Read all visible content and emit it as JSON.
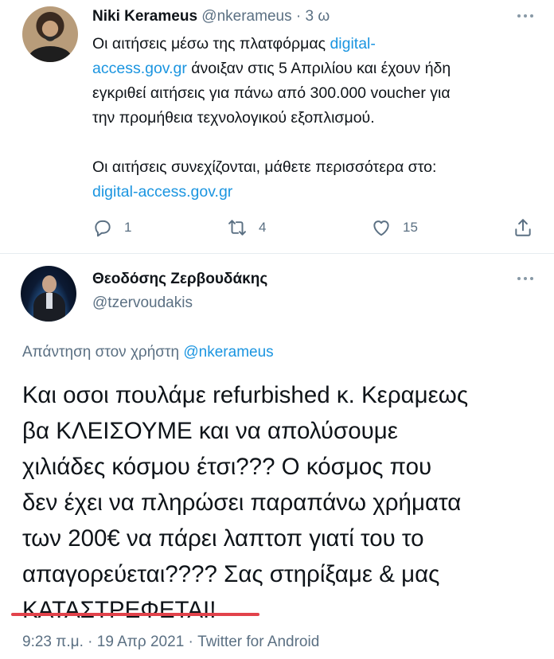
{
  "tweet1": {
    "author_name": "Niki Kerameus",
    "handle": "@nkerameus",
    "separator": "·",
    "time": "3 ω",
    "body_lines": [
      [
        {
          "text": "Οι αιτήσεις μέσω της πλατφόρμας ",
          "link": false
        },
        {
          "text": "digital-",
          "link": true
        }
      ],
      [
        {
          "text": "access.gov.gr",
          "link": true
        },
        {
          "text": " άνοιξαν στις 5 Απριλίου και έχουν ήδη",
          "link": false
        }
      ],
      [
        {
          "text": "εγκριθεί αιτήσεις για πάνω από 300.000 voucher για",
          "link": false
        }
      ],
      [
        {
          "text": "την προμήθεια τεχνολογικού εξοπλισμού.",
          "link": false
        }
      ],
      [],
      [
        {
          "text": "Οι αιτήσεις συνεχίζονται, μάθετε περισσότερα στο:",
          "link": false
        }
      ],
      [
        {
          "text": "digital-access.gov.gr",
          "link": true
        }
      ]
    ],
    "actions": {
      "reply_count": "1",
      "retweet_count": "4",
      "like_count": "15"
    }
  },
  "tweet2": {
    "author_name": "Θεοδόσης Ζερβουδάκης",
    "handle": "@tzervoudakis",
    "reply_prefix": "Απάντηση στον χρήστη ",
    "reply_handle": "@nkerameus",
    "body_lines": [
      "Και οσοι πουλάμε refurbished κ. Κεραμεως",
      "βα ΚΛΕΙΣΟΥΜΕ και να απολύσουμε",
      "χιλιάδες κόσμου έτσι???  Ο κόσμος που",
      "δεν έχει να πληρώσει παραπάνω χρήματα",
      "των 200€ να πάρει λαπτοπ γιατί του το",
      "απαγορεύεται????  Σας στηρίξαμε & μας",
      "ΚΑΤΑΣΤΡΕΦΕΤΑΙ!"
    ],
    "meta": "9:23 π.μ. · 19 Απρ 2021 · Twitter for Android"
  },
  "colors": {
    "link": "#1b95e0",
    "muted": "#5b7083",
    "underline": "#e2424b"
  }
}
